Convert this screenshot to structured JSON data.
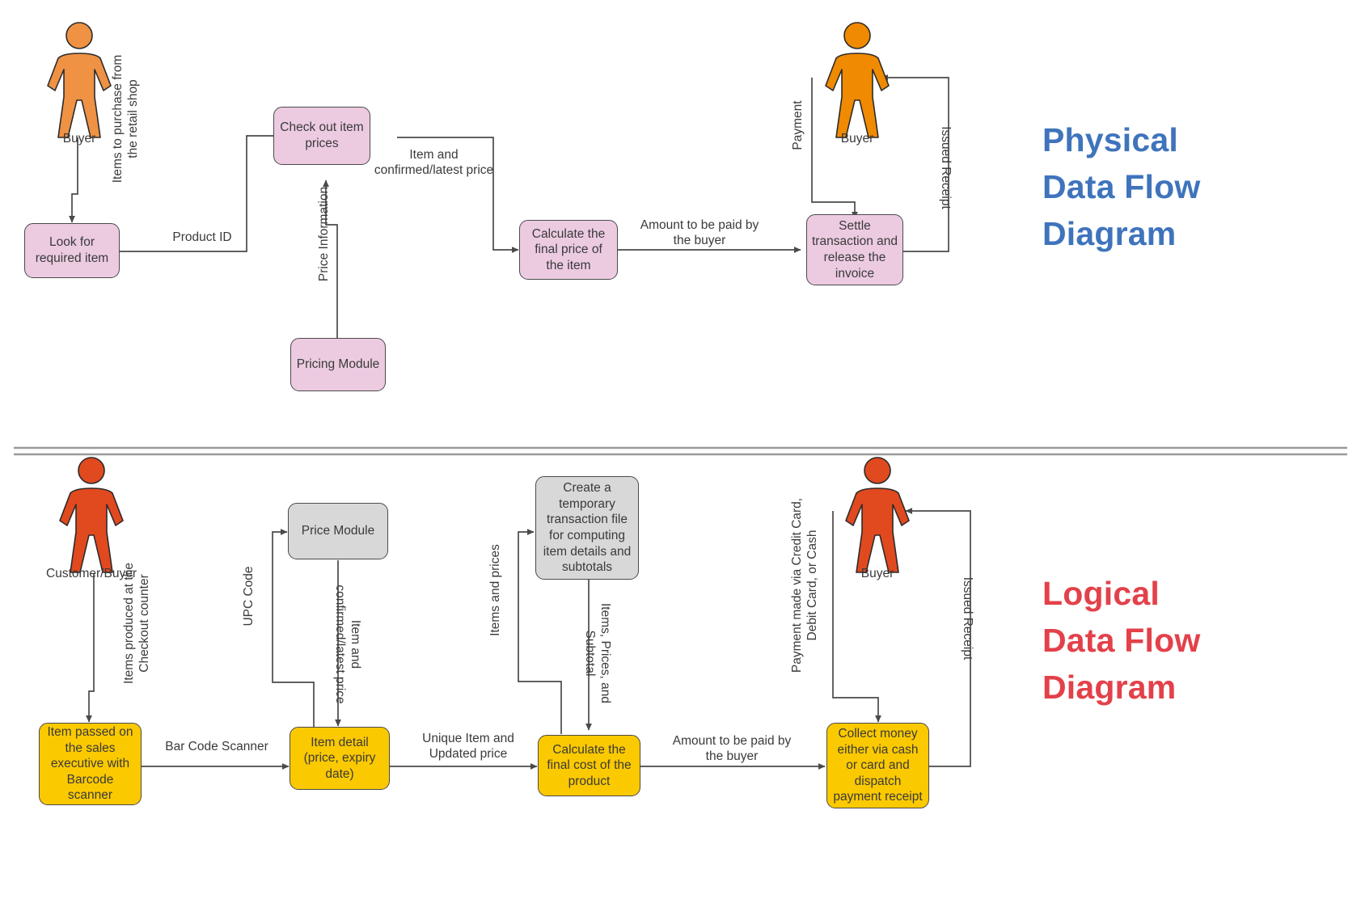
{
  "page": {
    "divider": {
      "color": "#9a9a9a"
    }
  },
  "physical": {
    "title": "Physical\nData Flow\nDiagram",
    "title_color": "#3f74bc",
    "actor_color": "#ef9244",
    "node_color": "#eccbe1",
    "actors": [
      {
        "name": "Buyer"
      },
      {
        "name": "Buyer"
      }
    ],
    "nodes": [
      {
        "id": "look-for-required-item",
        "label": "Look for\nrequired item",
        "shape": "process",
        "fill": "#eccbe1"
      },
      {
        "id": "check-out-item-prices",
        "label": "Check out item\nprices",
        "shape": "process",
        "fill": "#eccbe1"
      },
      {
        "id": "pricing-module",
        "label": "Pricing Module",
        "shape": "process",
        "fill": "#eccbe1"
      },
      {
        "id": "calculate-final-price",
        "label": "Calculate the\nfinal price of the\nitem",
        "shape": "process",
        "fill": "#eccbe1"
      },
      {
        "id": "settle-transaction",
        "label": "Settle\ntransaction and\nrelease the\ninvoice",
        "shape": "process",
        "fill": "#eccbe1"
      }
    ],
    "flows": [
      {
        "id": "items-to-purchase",
        "label": "Items to purchase from\nthe retail shop"
      },
      {
        "id": "product-id",
        "label": "Product ID"
      },
      {
        "id": "price-information",
        "label": "Price Information"
      },
      {
        "id": "item-and-confirmed-latest-price",
        "label": "Item and\nconfirmed/latest price"
      },
      {
        "id": "amount-to-be-paid",
        "label": "Amount to be paid by\nthe buyer"
      },
      {
        "id": "payment",
        "label": "Payment"
      },
      {
        "id": "issued-receipt",
        "label": "Issued Receipt"
      }
    ]
  },
  "logical": {
    "title": "Logical\nData Flow\nDiagram",
    "title_color": "#e3414a",
    "actor_color": "#e1491f",
    "node_color": "#fbc900",
    "store_color": "#d8d8d8",
    "actors": [
      {
        "name": "Customer/Buyer"
      },
      {
        "name": "Buyer"
      }
    ],
    "nodes": [
      {
        "id": "item-passed-on-sales-executive",
        "label": "Item passed on\nthe sales\nexecutive with\nBarcode scanner",
        "shape": "process",
        "fill": "#fbc900"
      },
      {
        "id": "price-module",
        "label": "Price Module",
        "shape": "store",
        "fill": "#d8d8d8"
      },
      {
        "id": "item-detail",
        "label": "Item detail\n(price, expiry\ndate)",
        "shape": "process",
        "fill": "#fbc900"
      },
      {
        "id": "create-temp-transaction-file",
        "label": "Create a\ntemporary\ntransaction file\nfor computing\nitem details and\nsubtotals",
        "shape": "store",
        "fill": "#d8d8d8"
      },
      {
        "id": "calculate-final-cost",
        "label": "Calculate the\nfinal cost of the\nproduct",
        "shape": "process",
        "fill": "#fbc900"
      },
      {
        "id": "collect-money",
        "label": "Collect money\neither via cash\nor card and\ndispatch\npayment receipt",
        "shape": "process",
        "fill": "#fbc900"
      }
    ],
    "flows": [
      {
        "id": "items-produced-checkout",
        "label": "Items produced at the\nCheckout counter"
      },
      {
        "id": "bar-code-scanner",
        "label": "Bar Code Scanner"
      },
      {
        "id": "upc-code",
        "label": "UPC Code"
      },
      {
        "id": "item-and-confirmed-latest-price",
        "label": "Item and\nconfirmed/latest price"
      },
      {
        "id": "unique-item-updated-price",
        "label": "Unique Item and\nUpdated price"
      },
      {
        "id": "items-and-prices",
        "label": "Items and prices"
      },
      {
        "id": "items-prices-subtotal",
        "label": "Items, Prices, and\nSubtotal"
      },
      {
        "id": "amount-to-be-paid",
        "label": "Amount to be paid by\nthe buyer"
      },
      {
        "id": "payment-made-via",
        "label": "Payment made via Credit Card,\nDebit Card, or Cash"
      },
      {
        "id": "issued-receipt",
        "label": "Issued Receipt"
      }
    ]
  }
}
